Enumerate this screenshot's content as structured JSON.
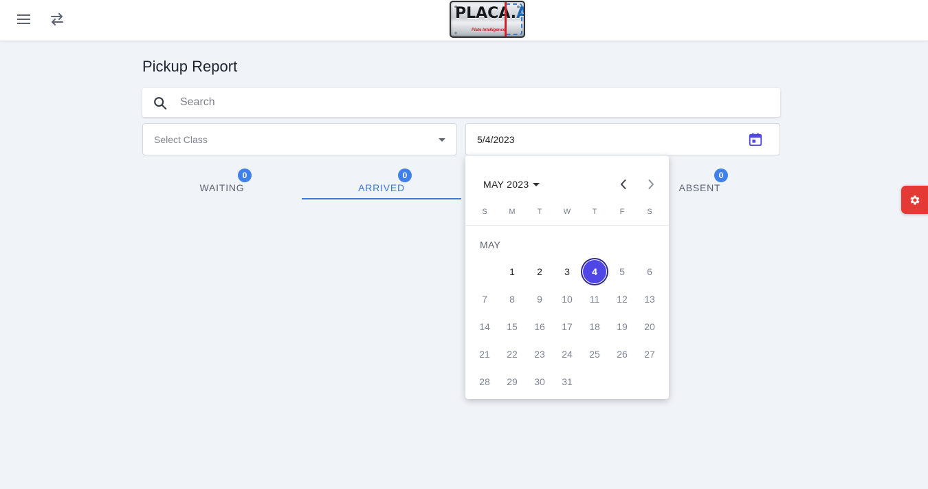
{
  "header": {
    "menu_icon": "hamburger-menu-icon",
    "swap_icon": "swap-arrows-icon",
    "logo": {
      "text_main": "PLACA.",
      "text_accent": "AI",
      "tagline": "Plate Intelligence"
    }
  },
  "page": {
    "title": "Pickup Report"
  },
  "search": {
    "placeholder": "Search"
  },
  "filters": {
    "class_select": {
      "placeholder": "Select Class"
    },
    "date": {
      "value": "5/4/2023"
    }
  },
  "tabs": [
    {
      "label": "WAITING",
      "count": "0",
      "active": false
    },
    {
      "label": "ARRIVED",
      "count": "0",
      "active": true
    },
    {
      "label": "ABSENT",
      "count": "0",
      "active": false
    }
  ],
  "calendar": {
    "header": "MAY 2023",
    "month_label": "MAY",
    "weekdays": [
      "S",
      "M",
      "T",
      "W",
      "T",
      "F",
      "S"
    ],
    "selected_day": "4",
    "days": [
      "1",
      "2",
      "3",
      "4",
      "5",
      "6",
      "7",
      "8",
      "9",
      "10",
      "11",
      "12",
      "13",
      "14",
      "15",
      "16",
      "17",
      "18",
      "19",
      "20",
      "21",
      "22",
      "23",
      "24",
      "25",
      "26",
      "27",
      "28",
      "29",
      "30",
      "31"
    ],
    "first_weekday_index": 1
  },
  "colors": {
    "accent": "#3d78d8",
    "badge": "#3f80ea",
    "selected_day": "#4f46e5",
    "settings_fab": "#e53935",
    "calendar_icon": "#4f46e5"
  }
}
